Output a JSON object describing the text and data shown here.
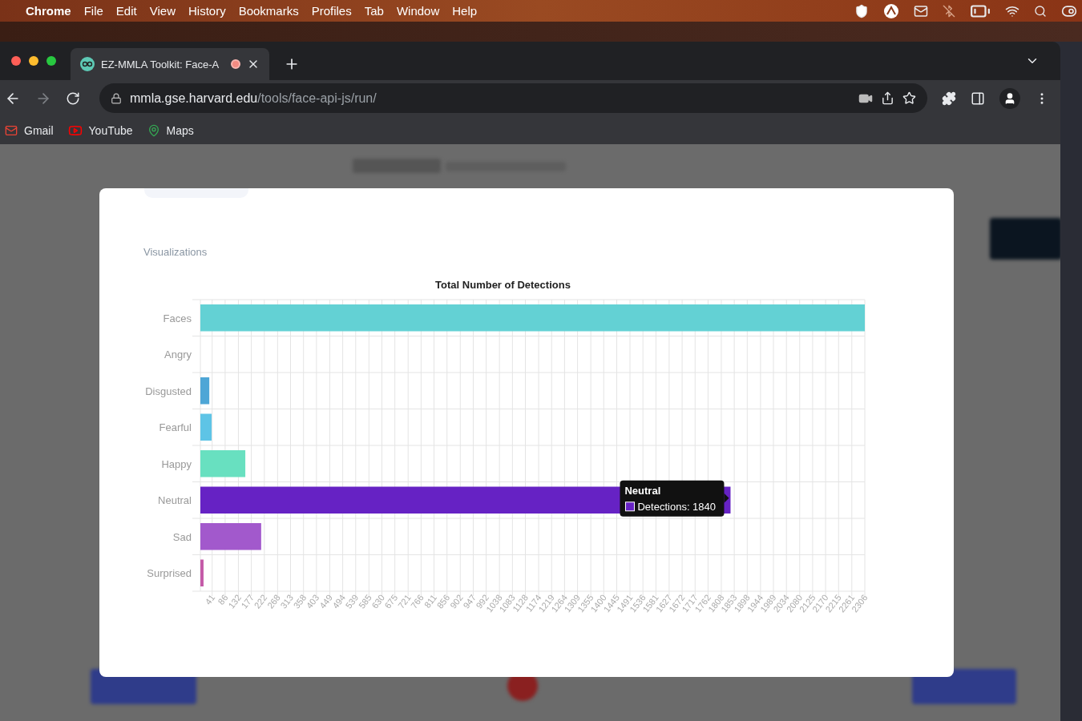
{
  "menu_bar": {
    "app": "Chrome",
    "items": [
      "File",
      "Edit",
      "View",
      "History",
      "Bookmarks",
      "Profiles",
      "Tab",
      "Window",
      "Help"
    ]
  },
  "browser": {
    "tab": {
      "title": "EZ-MMLA Toolkit: Face-A",
      "recording": true
    },
    "address": {
      "host": "mmla.gse.harvard.edu",
      "path": "/tools/face-api-js/run/"
    },
    "bookmarks": [
      {
        "kind": "mail",
        "label": "Gmail"
      },
      {
        "kind": "video",
        "label": "YouTube"
      },
      {
        "kind": "map",
        "label": "Maps"
      }
    ]
  },
  "modal": {
    "section_label": "Visualizations",
    "chart_data": {
      "type": "bar",
      "orientation": "horizontal",
      "title": "Total Number of Detections",
      "categories": [
        "Faces",
        "Angry",
        "Disgusted",
        "Fearful",
        "Happy",
        "Neutral",
        "Sad",
        "Surprised"
      ],
      "series": [
        {
          "color": [
            "#63d1d4",
            null,
            "#4ea6d6",
            "#5ec4e6",
            "#68e0c0",
            "#6622c4",
            "#a259cc",
            "#c45aa8"
          ],
          "values": [
            2306,
            0,
            31,
            39,
            156,
            1840,
            211,
            11
          ]
        }
      ],
      "grid": true,
      "xlim": [
        0,
        2306
      ],
      "xticks": [
        41,
        86,
        132,
        177,
        222,
        268,
        313,
        358,
        403,
        449,
        494,
        539,
        585,
        630,
        675,
        721,
        766,
        811,
        856,
        902,
        947,
        992,
        1038,
        1083,
        1128,
        1174,
        1219,
        1264,
        1309,
        1355,
        1400,
        1445,
        1491,
        1536,
        1581,
        1627,
        1672,
        1717,
        1762,
        1808,
        1853,
        1898,
        1944,
        1989,
        2034,
        2080,
        2125,
        2170,
        2215,
        2261,
        2306
      ]
    },
    "tooltip": {
      "title": "Neutral",
      "text": "Detections: 1840"
    }
  }
}
